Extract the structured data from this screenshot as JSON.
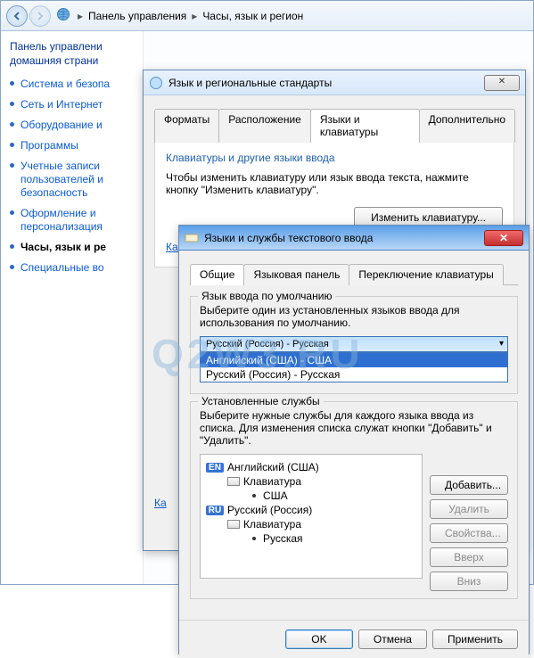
{
  "breadcrumb": {
    "root": "Панель управления",
    "sub": "Часы, язык и регион"
  },
  "sidebar": {
    "hdr1": "Панель управлени",
    "hdr2": "домашняя страни",
    "items": [
      "Система и безопа",
      "Сеть и Интернет",
      "Оборудование и",
      "Программы",
      "Учетные записи пользователей и безопасность",
      "Оформление и персонализация",
      "Часы, язык и ре",
      "Специальные во"
    ],
    "active_index": 6
  },
  "region_dialog": {
    "title": "Язык и региональные стандарты",
    "tabs": [
      "Форматы",
      "Расположение",
      "Языки и клавиатуры",
      "Дополнительно"
    ],
    "active_tab": 2,
    "kbd_heading": "Клавиатуры и другие языки ввода",
    "kbd_text": "Чтобы изменить клавиатуру или язык ввода текста, нажмите кнопку \"Изменить клавиатуру\".",
    "change_kbd_btn": "Изменить клавиатуру...",
    "welcome_link": "Как изменить раскладку клавиатуры на экране приветствия?",
    "apply_hint": "Ка"
  },
  "text_services": {
    "title": "Языки и службы текстового ввода",
    "tabs": [
      "Общие",
      "Языковая панель",
      "Переключение клавиатуры"
    ],
    "active_tab": 0,
    "default_lang_legend": "Язык ввода по умолчанию",
    "default_lang_text": "Выберите один из установленных языков ввода для использования по умолчанию.",
    "combo_value": "Русский (Россия) - Русская",
    "dropdown_items": [
      "Английский (США) - США",
      "Русский (Россия) - Русская"
    ],
    "dropdown_selected": 0,
    "installed_legend": "Установленные службы",
    "installed_text": "Выберите нужные службы для каждого языка ввода из списка. Для изменения списка служат кнопки \"Добавить\" и \"Удалить\".",
    "tree": {
      "en": {
        "badge": "EN",
        "name": "Английский (США)",
        "kbd_label": "Клавиатура",
        "layout": "США"
      },
      "ru": {
        "badge": "RU",
        "name": "Русский (Россия)",
        "kbd_label": "Клавиатура",
        "layout": "Русская"
      }
    },
    "buttons": {
      "add": "Добавить...",
      "remove": "Удалить",
      "props": "Свойства...",
      "up": "Вверх",
      "down": "Вниз"
    },
    "footer": {
      "ok": "OK",
      "cancel": "Отмена",
      "apply": "Применить"
    }
  },
  "watermark": "Q2W3.RU"
}
